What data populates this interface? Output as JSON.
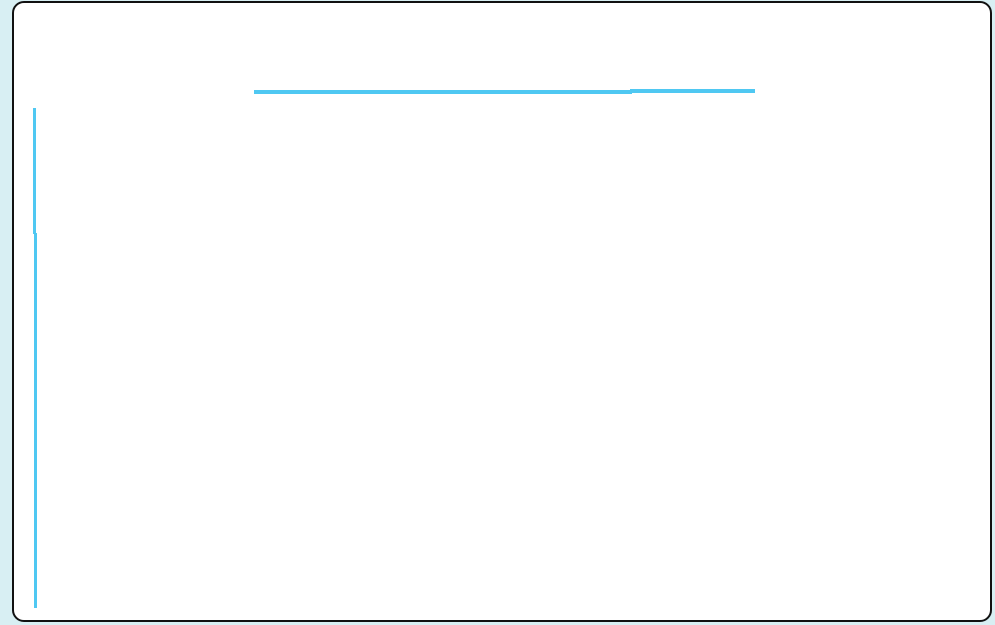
{
  "screen": {
    "background_color": "#d8eff3",
    "canvas_background_color": "#ffffff",
    "frame_border_color": "#111111",
    "stroke_color": "#4fc8f2",
    "visible_text": []
  }
}
